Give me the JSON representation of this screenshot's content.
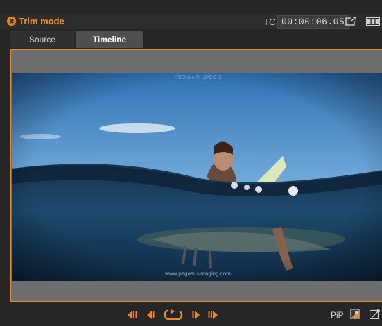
{
  "window": {
    "title": "Trim mode",
    "timecode_label": "TC",
    "timecode_value": "00:00:06.05"
  },
  "tabs": [
    {
      "label": "Source",
      "active": false
    },
    {
      "label": "Timeline",
      "active": true
    }
  ],
  "preview": {
    "watermark_top": "FSOoos M JPEG 3",
    "watermark_bottom": "www.pegasusimaging.com"
  },
  "transport": {
    "buttons": [
      "go-to-start-icon",
      "step-back-icon",
      "loop-play-icon",
      "step-forward-icon",
      "go-to-end-icon"
    ]
  },
  "pip": {
    "label": "PiP"
  },
  "colors": {
    "accent": "#f08a1d",
    "background": "#262626",
    "active_tab": "#4f4f4f"
  }
}
